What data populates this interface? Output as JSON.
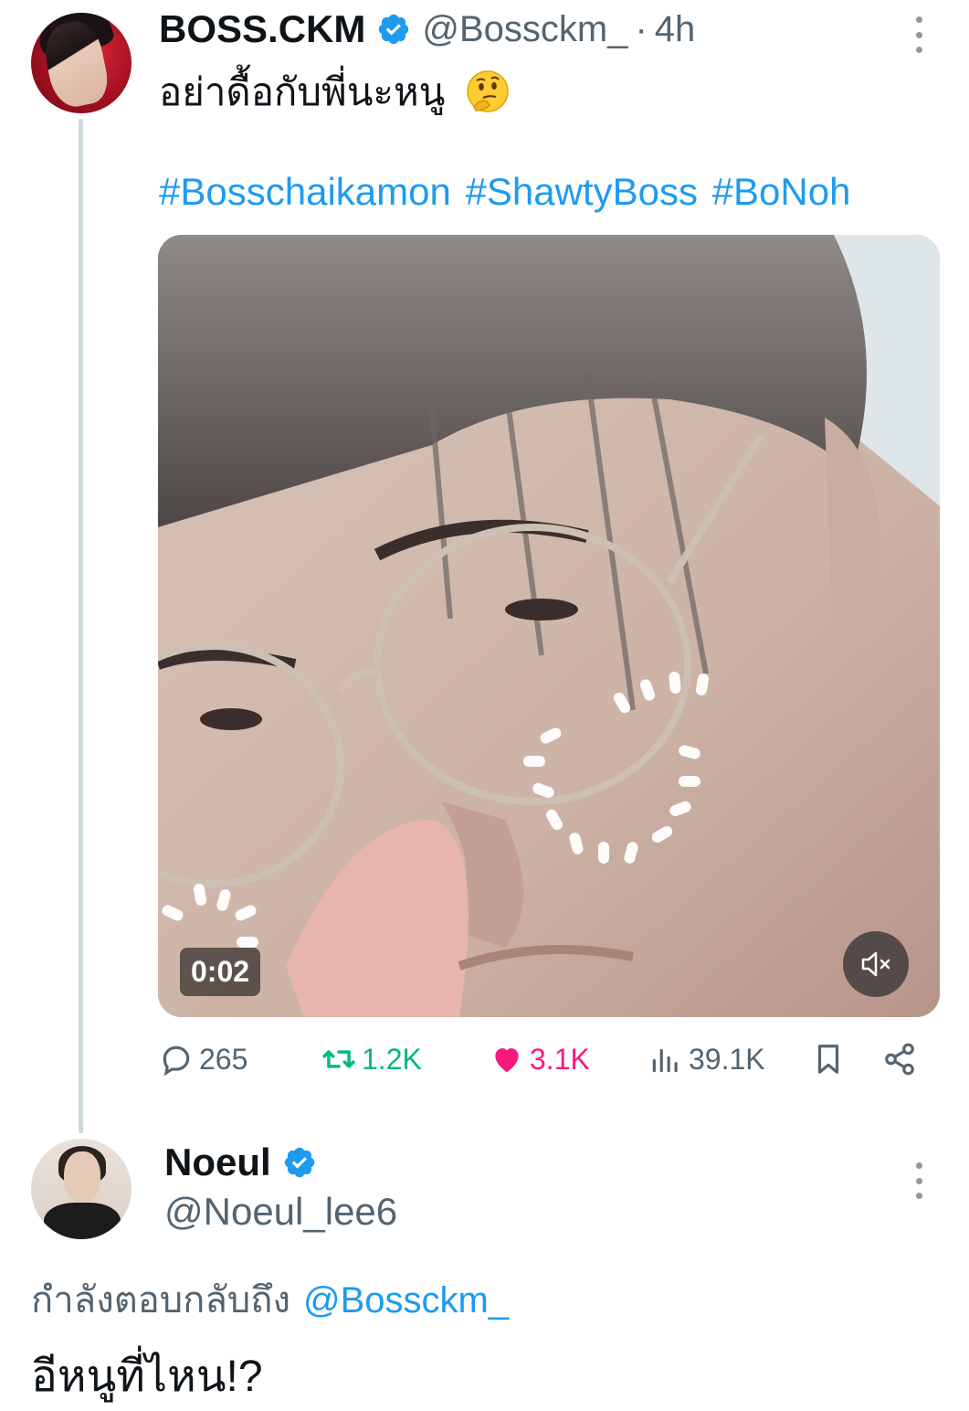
{
  "colors": {
    "accent": "#1d9bf0",
    "retweet": "#00ba7c",
    "like": "#f91880",
    "secondary_text": "#536471"
  },
  "tweet": {
    "display_name": "BOSS.CKM",
    "verified": true,
    "handle": "@Bossckm_",
    "separator": "·",
    "time": "4h",
    "text": "อย่าดื้อกับพี่นะหนู",
    "emoji": "thinking-face",
    "hashtags": [
      "#Bosschaikamon",
      "#ShawtyBoss",
      "#BoNoh"
    ],
    "media": {
      "type": "video",
      "duration": "0:02",
      "muted": true,
      "loading": true
    },
    "actions": {
      "replies": "265",
      "retweets": "1.2K",
      "likes": "3.1K",
      "views": "39.1K"
    }
  },
  "reply": {
    "display_name": "Noeul",
    "verified": true,
    "handle": "@Noeul_lee6",
    "replying_to_label": "กำลังตอบกลับถึง",
    "replying_to_handle": "@Bossckm_",
    "text": "อีหนูที่ไหน!?"
  }
}
